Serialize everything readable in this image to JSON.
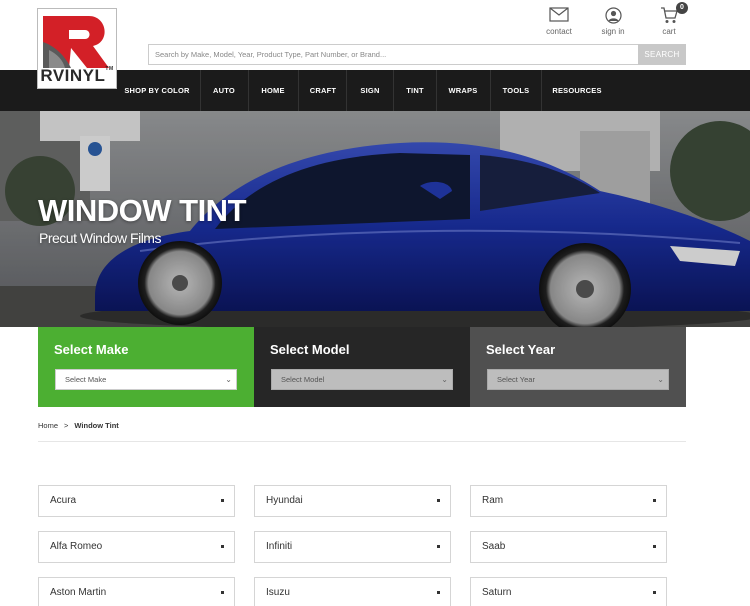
{
  "logo": {
    "text": "RVINYL",
    "tm": "TM"
  },
  "utility": {
    "contact_label": "contact",
    "signin_label": "sign in",
    "cart_label": "cart",
    "cart_count": "0"
  },
  "search": {
    "placeholder": "Search by Make, Model, Year, Product Type, Part Number, or Brand...",
    "button_label": "SEARCH"
  },
  "nav": {
    "items": [
      "SHOP BY COLOR",
      "AUTO",
      "HOME",
      "CRAFT",
      "SIGN",
      "TINT",
      "WRAPS",
      "TOOLS",
      "RESOURCES"
    ]
  },
  "hero": {
    "title": "WINDOW TINT",
    "subtitle": "Precut Window Films"
  },
  "selectors": [
    {
      "heading": "Select Make",
      "value": "Select Make",
      "color": "#4caf32"
    },
    {
      "heading": "Select Model",
      "value": "Select Model",
      "color": "#262626"
    },
    {
      "heading": "Select Year",
      "value": "Select Year",
      "color": "#505050"
    }
  ],
  "breadcrumb": {
    "home": "Home",
    "separator": ">",
    "current": "Window Tint"
  },
  "makes": [
    [
      "Acura",
      "Hyundai",
      "Ram"
    ],
    [
      "Alfa Romeo",
      "Infiniti",
      "Saab"
    ],
    [
      "Aston Martin",
      "Isuzu",
      "Saturn"
    ]
  ],
  "colors": {
    "nav_bg": "#1b1b1b",
    "accent_green": "#4caf32",
    "logo_red": "#d32027"
  }
}
